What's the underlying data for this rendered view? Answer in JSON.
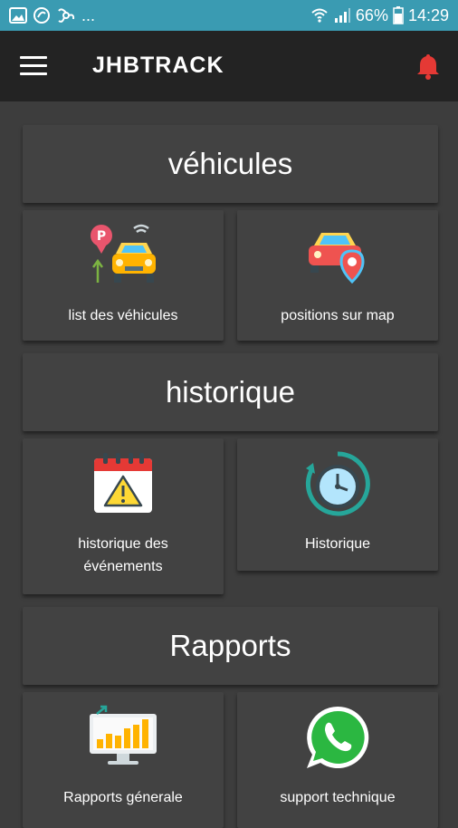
{
  "status_bar": {
    "left_icons": [
      "image-icon",
      "sync-icon",
      "fan-icon"
    ],
    "more": "...",
    "battery_percent": "66%",
    "time": "14:29"
  },
  "app_bar": {
    "title": "JHBTRACK",
    "menu_icon": "hamburger-menu-icon",
    "notification_icon": "bell-icon",
    "accent": "#e53935"
  },
  "sections": {
    "vehicules": {
      "title": "véhicules",
      "tiles": [
        {
          "label": "list des véhicules",
          "icon": "vehicle-parking-icon"
        },
        {
          "label": "positions sur map",
          "icon": "car-location-pin-icon"
        }
      ]
    },
    "historique": {
      "title": "historique",
      "tiles": [
        {
          "label_line1": "historique des",
          "label_line2": "événements",
          "icon": "calendar-warning-icon"
        },
        {
          "label": "Historique",
          "icon": "clock-history-icon"
        }
      ]
    },
    "rapports": {
      "title": "Rapports",
      "tiles": [
        {
          "label": "Rapports génerale",
          "icon": "bar-chart-monitor-icon"
        },
        {
          "label": "support technique",
          "icon": "whatsapp-icon"
        }
      ]
    }
  },
  "colors": {
    "status_bar": "#3a9bb2",
    "app_bar": "#232323",
    "background": "#3d3d3d",
    "card": "#424242"
  }
}
